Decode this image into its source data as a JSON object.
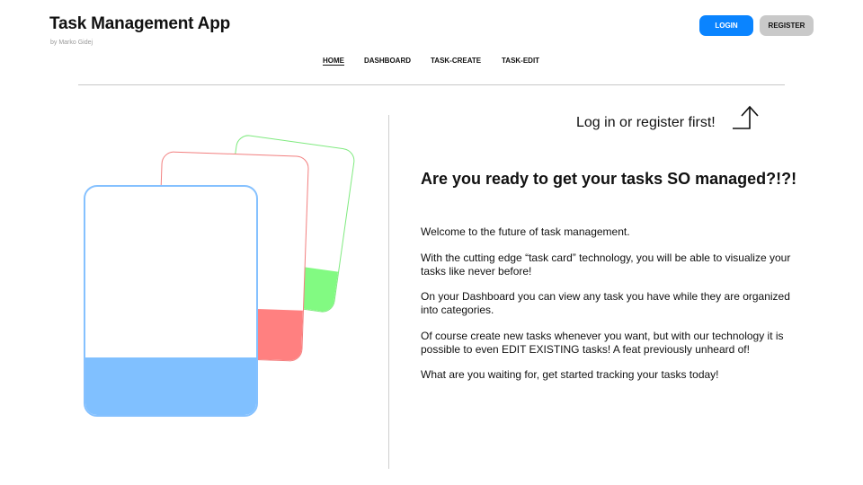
{
  "header": {
    "title": "Task Management App",
    "byline": "by Marko Gidej",
    "login_label": "LOGIN",
    "register_label": "REGISTER"
  },
  "nav": {
    "items": [
      {
        "label": "HOME",
        "active": true
      },
      {
        "label": "DASHBOARD",
        "active": false
      },
      {
        "label": "TASK-CREATE",
        "active": false
      },
      {
        "label": "TASK-EDIT",
        "active": false
      }
    ]
  },
  "hero": {
    "hint": "Log in or register first!",
    "headline": "Are you ready to get your tasks SO managed?!?!",
    "paragraphs": [
      "Welcome to the future of task management.",
      "With the cutting edge “task card” technology, you will be able to visualize your tasks like never before!",
      "On your Dashboard you can view any task you have while they are organized into categories.",
      "Of course create new tasks whenever you want, but with our technology it is possible to even EDIT EXISTING tasks! A feat previously unheard of!",
      "What are you waiting for, get started tracking your tasks today!"
    ]
  },
  "illustration": {
    "cards": [
      {
        "color": "#82fa82",
        "icon": "task-card-green"
      },
      {
        "color": "#ff8080",
        "icon": "task-card-red"
      },
      {
        "color": "#80c0ff",
        "icon": "task-card-blue"
      }
    ]
  },
  "colors": {
    "accent": "#0a84ff",
    "register_button": "#c9c9c9"
  }
}
